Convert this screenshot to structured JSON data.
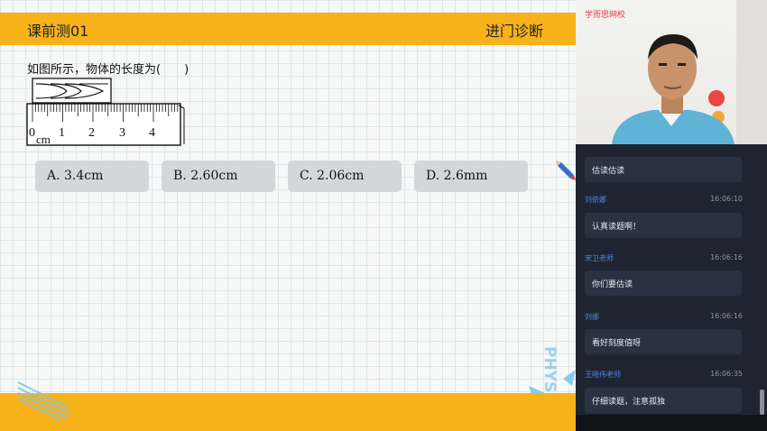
{
  "slide": {
    "title": "课前测01",
    "section": "进门诊断",
    "question": "如图所示，物体的长度为(　　)",
    "ruler": {
      "unit": "cm",
      "ticks": [
        "0",
        "1",
        "2",
        "3",
        "4"
      ]
    },
    "choices": [
      {
        "label": "A. 3.4cm"
      },
      {
        "label": "B. 2.60cm"
      },
      {
        "label": "C. 2.06cm"
      },
      {
        "label": "D. 2.6mm"
      }
    ],
    "watermark": "PHYSICS"
  },
  "webcam": {
    "logo": "学而思网校"
  },
  "chat": {
    "messages": [
      {
        "text": "估读估读"
      },
      {
        "name": "刘依娜",
        "time": "16:06:10",
        "text": "认真读题啊！"
      },
      {
        "name": "宋卫老师",
        "time": "16:06:16",
        "text": "你们要估读"
      },
      {
        "name": "刘娜",
        "time": "16:06:16",
        "text": "看好刻度值呀"
      },
      {
        "name": "王晓伟老师",
        "time": "16:06:35",
        "text": "仔细读题，注意孤独"
      }
    ]
  },
  "colors": {
    "accent": "#f8b21a",
    "chat_bg": "#1f2530",
    "chat_name": "#4f86e6",
    "logo_red": "#e8383d"
  }
}
